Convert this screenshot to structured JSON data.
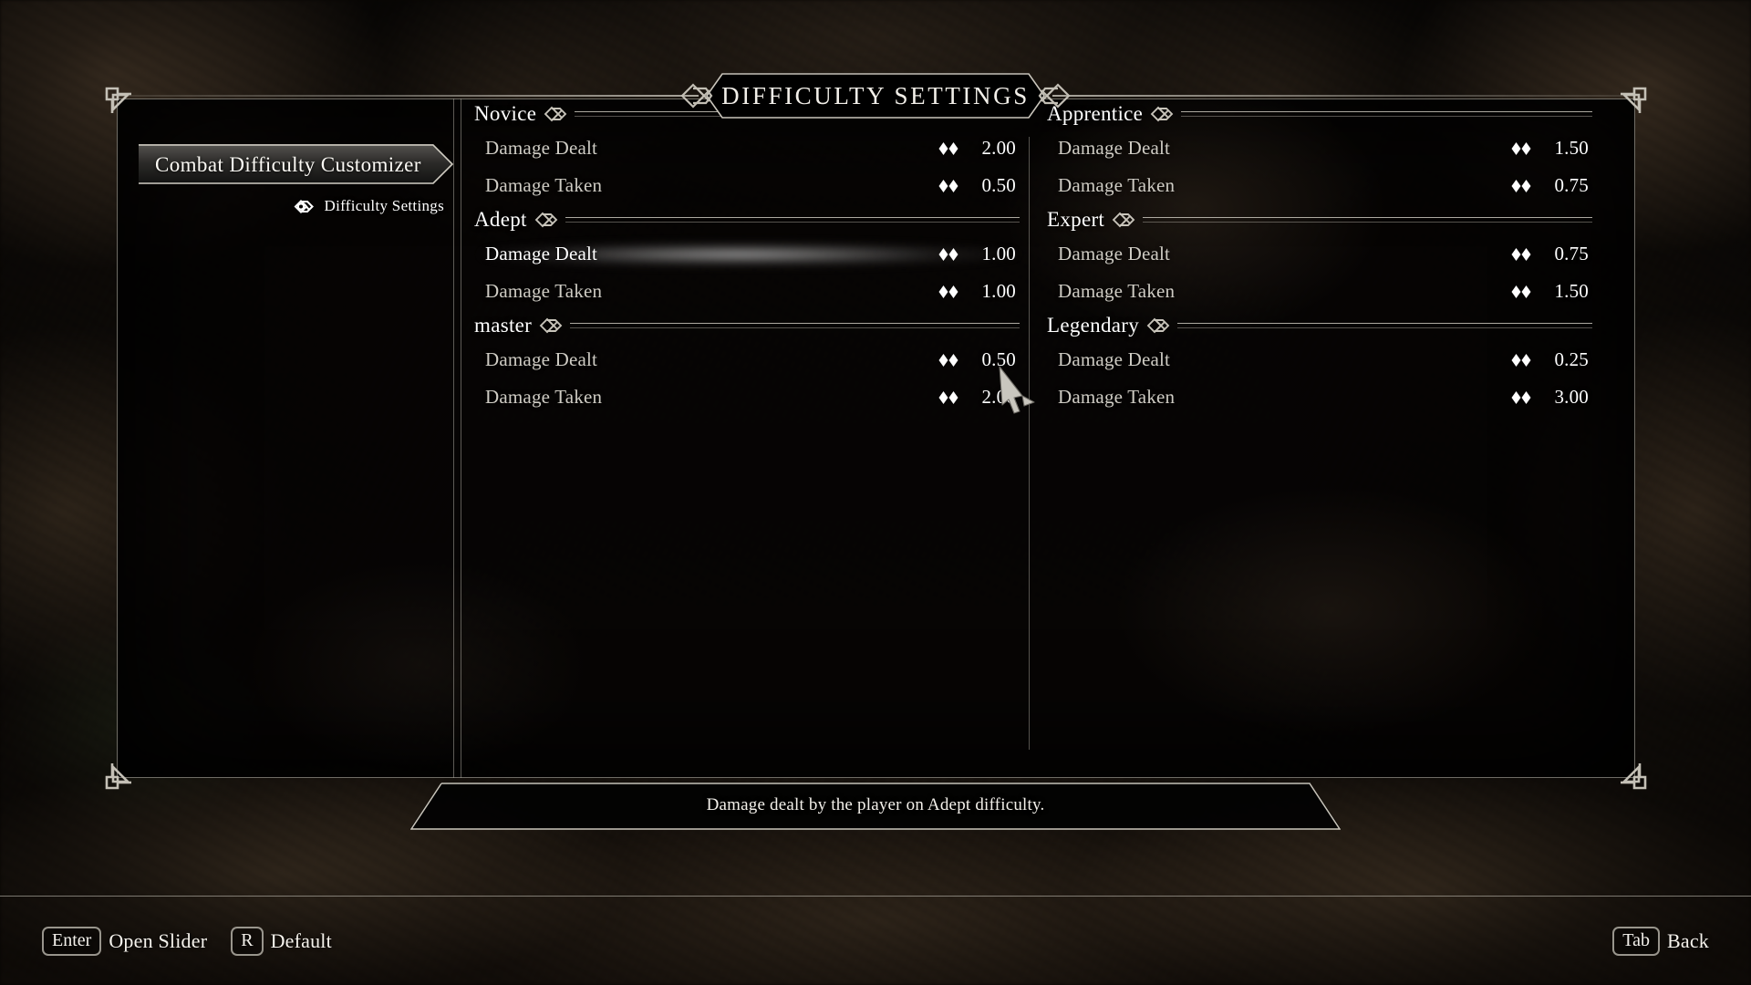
{
  "window": {
    "title": "DIFFICULTY SETTINGS"
  },
  "sidebar": {
    "mod_title": "Combat Difficulty Customizer",
    "items": [
      {
        "label": "Difficulty Settings",
        "icon": "knot-badge-icon",
        "selected": true
      }
    ]
  },
  "columns": {
    "left": [
      {
        "name": "Novice",
        "rows": [
          {
            "label": "Damage Dealt",
            "value": "2.00",
            "selected": false
          },
          {
            "label": "Damage Taken",
            "value": "0.50",
            "selected": false
          }
        ]
      },
      {
        "name": "Adept",
        "rows": [
          {
            "label": "Damage Dealt",
            "value": "1.00",
            "selected": true
          },
          {
            "label": "Damage Taken",
            "value": "1.00",
            "selected": false
          }
        ]
      },
      {
        "name": "master",
        "rows": [
          {
            "label": "Damage Dealt",
            "value": "0.50",
            "selected": false
          },
          {
            "label": "Damage Taken",
            "value": "2.00",
            "selected": false
          }
        ]
      }
    ],
    "right": [
      {
        "name": "Apprentice",
        "rows": [
          {
            "label": "Damage Dealt",
            "value": "1.50",
            "selected": false
          },
          {
            "label": "Damage Taken",
            "value": "0.75",
            "selected": false
          }
        ]
      },
      {
        "name": "Expert",
        "rows": [
          {
            "label": "Damage Dealt",
            "value": "0.75",
            "selected": false
          },
          {
            "label": "Damage Taken",
            "value": "1.50",
            "selected": false
          }
        ]
      },
      {
        "name": "Legendary",
        "rows": [
          {
            "label": "Damage Dealt",
            "value": "0.25",
            "selected": false
          },
          {
            "label": "Damage Taken",
            "value": "3.00",
            "selected": false
          }
        ]
      }
    ]
  },
  "tooltip": {
    "text": "Damage dealt by the player on Adept difficulty."
  },
  "keybinds": {
    "left": [
      {
        "key": "Enter",
        "action": "Open Slider"
      },
      {
        "key": "R",
        "action": "Default"
      }
    ],
    "right": [
      {
        "key": "Tab",
        "action": "Back"
      }
    ]
  },
  "colors": {
    "frame": "#bcb8ae",
    "text_primary": "#ffffff",
    "text_muted": "#cfccc4",
    "panel_bg": "#040302",
    "highlight_glow": "#e8e8e8"
  }
}
